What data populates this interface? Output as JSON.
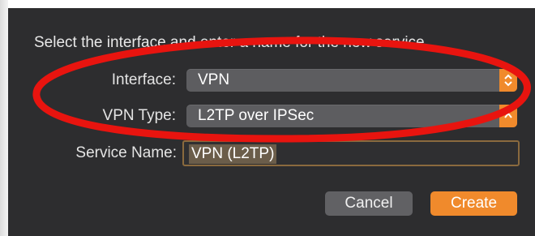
{
  "dialog": {
    "prompt": "Select the interface and enter a name for the new service."
  },
  "form": {
    "interface_label": "Interface:",
    "interface_value": "VPN",
    "vpn_type_label": "VPN Type:",
    "vpn_type_value": "L2TP over IPSec",
    "service_name_label": "Service Name:",
    "service_name_value": "VPN (L2TP)"
  },
  "buttons": {
    "cancel": "Cancel",
    "create": "Create"
  },
  "colors": {
    "accent": "#f08a2c",
    "annotation": "#e8140f",
    "dialog_bg": "#2d2d2f"
  },
  "icons": [
    "chevron-updown-icon",
    "chevron-up-icon"
  ]
}
